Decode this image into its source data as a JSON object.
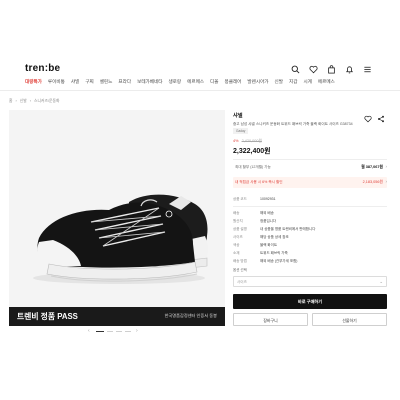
{
  "header": {
    "logo": "tren:be",
    "icons": [
      "search-icon",
      "heart-icon",
      "bag-icon",
      "bell-icon",
      "menu-icon"
    ]
  },
  "nav": {
    "items": [
      {
        "label": "대량특가",
        "active": true
      },
      {
        "label": "루이비통",
        "active": false
      },
      {
        "label": "샤넬",
        "active": false
      },
      {
        "label": "구찌",
        "active": false
      },
      {
        "label": "셀린느",
        "active": false
      },
      {
        "label": "프라다",
        "active": false
      },
      {
        "label": "보테가베네타",
        "active": false
      },
      {
        "label": "생로랑",
        "active": false
      },
      {
        "label": "에르메스",
        "active": false
      },
      {
        "label": "디올",
        "active": false
      },
      {
        "label": "몽클레어",
        "active": false
      },
      {
        "label": "발렌시아가",
        "active": false
      },
      {
        "label": "신발",
        "active": false
      },
      {
        "label": "지갑",
        "active": false
      },
      {
        "label": "시계",
        "active": false
      },
      {
        "label": "에르메스",
        "active": false
      }
    ]
  },
  "breadcrumb": [
    "홈",
    "신발",
    "스니커즈/운동화"
  ],
  "banner": {
    "title": "트렌비 정품 PASS",
    "subtitle": "한국명품감정센터 인증서 동봉"
  },
  "product": {
    "brand": "샤넬",
    "title": "중고 남성 샤넬 스니커즈 운동화 트위드 패브릭 가죽 블랙 화이트 사이즈 G38734",
    "condition": "Gaday",
    "discount_rate": "4%",
    "original_price": "2,420,000원",
    "price": "2,322,400원"
  },
  "benefits": {
    "installment_label": "최대 할부 (12개월) 가능",
    "installment_value": "월 387,067원",
    "points_label": "내 적립금 사용 시 6% 즉시 할인",
    "points_value": "2,183,056원"
  },
  "specs": [
    {
      "key": "상품 코드",
      "value": "10092931"
    },
    {
      "key": "배송",
      "value": "해외 배송"
    },
    {
      "key": "원산지",
      "value": "정품입니다"
    },
    {
      "key": "상품 설명",
      "value": "내 상품을 명품 트렌비에서 판매합니다"
    },
    {
      "key": "사이즈",
      "value": "해당 상품 상세 참조"
    },
    {
      "key": "색상",
      "value": "블랙 화이트"
    },
    {
      "key": "소재",
      "value": "트위드 패브릭 가죽"
    },
    {
      "key": "배송 방법",
      "value": "해외 배송 (관부가세 포함)"
    }
  ],
  "option_label": "옵션 선택",
  "option": {
    "placeholder": "사이즈"
  },
  "buttons": {
    "buy": "바로 구매하기",
    "cart": "장바구니",
    "gift": "선물하기"
  },
  "colors": {
    "accent": "#e0413a",
    "primary": "#111111"
  }
}
